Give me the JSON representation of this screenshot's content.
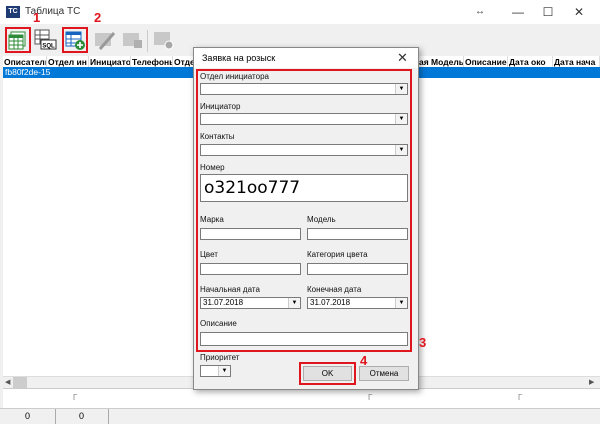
{
  "window": {
    "title": "Таблица ТС",
    "icon_text": "TC"
  },
  "toolbar": {
    "labels": [
      "1",
      "2"
    ]
  },
  "grid": {
    "columns": [
      "Описатель",
      "Отдел ин",
      "Инициато",
      "Телефонь",
      "Отде",
      "",
      "",
      "",
      "",
      "",
      "",
      "ая Модель",
      "Описание",
      "Дата око",
      "Дата нача"
    ],
    "rows": [
      {
        "id": "fb80f2de-15"
      }
    ]
  },
  "footer": {
    "cells": [
      "0",
      "0"
    ]
  },
  "dialog": {
    "title": "Заявка на розыск",
    "dept_label": "Отдел инициатора",
    "initiator_label": "Инициатор",
    "contacts_label": "Контакты",
    "number_label": "Номер",
    "number_value": "о321оо777",
    "brand_label": "Марка",
    "model_label": "Модель",
    "color_label": "Цвет",
    "color_category_label": "Категория цвета",
    "start_date_label": "Начальная дата",
    "start_date_value": "31.07.2018",
    "end_date_label": "Конечная дата",
    "end_date_value": "31.07.2018",
    "description_label": "Описание",
    "priority_label": "Приоритет",
    "ok_label": "OK",
    "cancel_label": "Отмена",
    "callouts": [
      "3",
      "4"
    ]
  },
  "colors": {
    "selection": "#0078d7",
    "callout": "#e0161e",
    "icon_green": "#2e8b3a",
    "icon_blue": "#1565c0"
  }
}
